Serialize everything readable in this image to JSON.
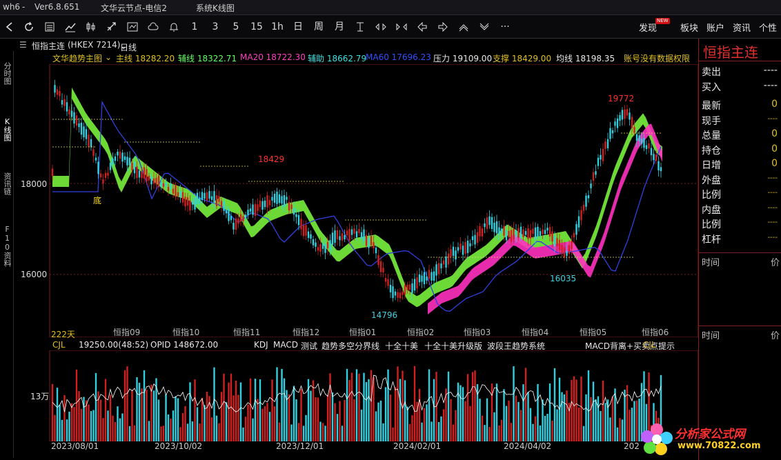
{
  "titlebar": {
    "app": "wh6",
    "version": "Ver6.8.651",
    "server": "文华云节点-电信2",
    "mode": "系统K线图"
  },
  "toolbar": {
    "periods": [
      "1",
      "3",
      "5",
      "15",
      "1h",
      "日",
      "周",
      "月"
    ],
    "right_items": [
      "发现",
      "板块",
      "账户",
      "资讯",
      "个性"
    ],
    "new_badge": "NEW"
  },
  "subhead": {
    "contract": "恒指主连",
    "code": "(HKEX 7214)",
    "period": "日线"
  },
  "left_tabs": [
    "分时图",
    "K线图",
    "资讯链",
    "F10资料"
  ],
  "indicator_row": [
    {
      "text": "文华趋势主图",
      "color": "#e0c020"
    },
    {
      "text": "主线 18282.20",
      "color": "#e0c020"
    },
    {
      "text": "辅线 18322.71",
      "color": "#60ff60"
    },
    {
      "text": "MA20 18722.30",
      "color": "#ff40c0"
    },
    {
      "text": "辅助 18662.79",
      "color": "#40e0e0"
    },
    {
      "text": "MA60 17696.23",
      "color": "#3050ff"
    },
    {
      "text": "压力 19109.00",
      "color": "#e8e8e8"
    },
    {
      "text": "支撑 18429.00",
      "color": "#e0c020"
    },
    {
      "text": "均线 18198.35",
      "color": "#e8e8e8"
    },
    {
      "text": "账号没有数据权限",
      "color": "#e0c020"
    }
  ],
  "chart": {
    "y_labels": [
      "18000",
      "16000"
    ],
    "annotations": {
      "high": "19772",
      "mid_high": "18429",
      "low": "14796",
      "mid_low": "16035",
      "bottom_mark": "底",
      "days": "222天"
    },
    "month_labels": [
      "恒指09",
      "恒指10",
      "恒指11",
      "恒指12",
      "恒指01",
      "恒指02",
      "恒指03",
      "恒指04",
      "恒指05",
      "恒指06"
    ],
    "date_labels": [
      "2023/08/01",
      "2023/10/02",
      "2023/12/01",
      "2024/02/01",
      "2024/04/02",
      "202"
    ]
  },
  "vol_header": [
    {
      "text": "CJL",
      "color": "#e0c020"
    },
    {
      "text": "19250.00(48:52)",
      "color": "#e8e8e8"
    },
    {
      "text": "OPID 148672.00",
      "color": "#e8e8e8"
    },
    {
      "text": "KDJ",
      "color": "#e8e8e8"
    },
    {
      "text": "MACD",
      "color": "#e8e8e8"
    },
    {
      "text": "测试",
      "color": "#e8e8e8"
    },
    {
      "text": "趋势多空分界线",
      "color": "#e8e8e8"
    },
    {
      "text": "十全十美",
      "color": "#e8e8e8"
    },
    {
      "text": "十全十美升级版",
      "color": "#e8e8e8"
    },
    {
      "text": "波段王趋势系统",
      "color": "#e8e8e8"
    },
    {
      "text": "MACD背离+买卖点提示",
      "color": "#e8e8e8"
    },
    {
      "text": "CJL",
      "color": "#e0c020"
    }
  ],
  "vol_axis_label": "13万",
  "right_panel": {
    "title": "恒指主连",
    "rows": [
      {
        "k": "卖出",
        "v": "----"
      },
      {
        "k": "买入",
        "v": "----"
      },
      {
        "k": "最新",
        "v": "0"
      },
      {
        "k": "现手",
        "v": "----"
      },
      {
        "k": "总量",
        "v": "0"
      },
      {
        "k": "持仓",
        "v": "0"
      },
      {
        "k": "日增",
        "v": "0"
      },
      {
        "k": "外盘",
        "v": "----"
      },
      {
        "k": "比例",
        "v": "----"
      },
      {
        "k": "内盘",
        "v": "----"
      },
      {
        "k": "比例",
        "v": "----"
      },
      {
        "k": "杠杆",
        "v": "----"
      }
    ],
    "time_header": "时间",
    "price_header": "价"
  },
  "logo": {
    "line1": "分析家公式网",
    "line2": "www.70822.com"
  },
  "colors": {
    "up": "#d02020",
    "down": "#30d0e0",
    "green_band": "#80ff40",
    "magenta_band": "#ff30c0",
    "ma60": "#3040e0",
    "yellow": "#e0c020"
  }
}
